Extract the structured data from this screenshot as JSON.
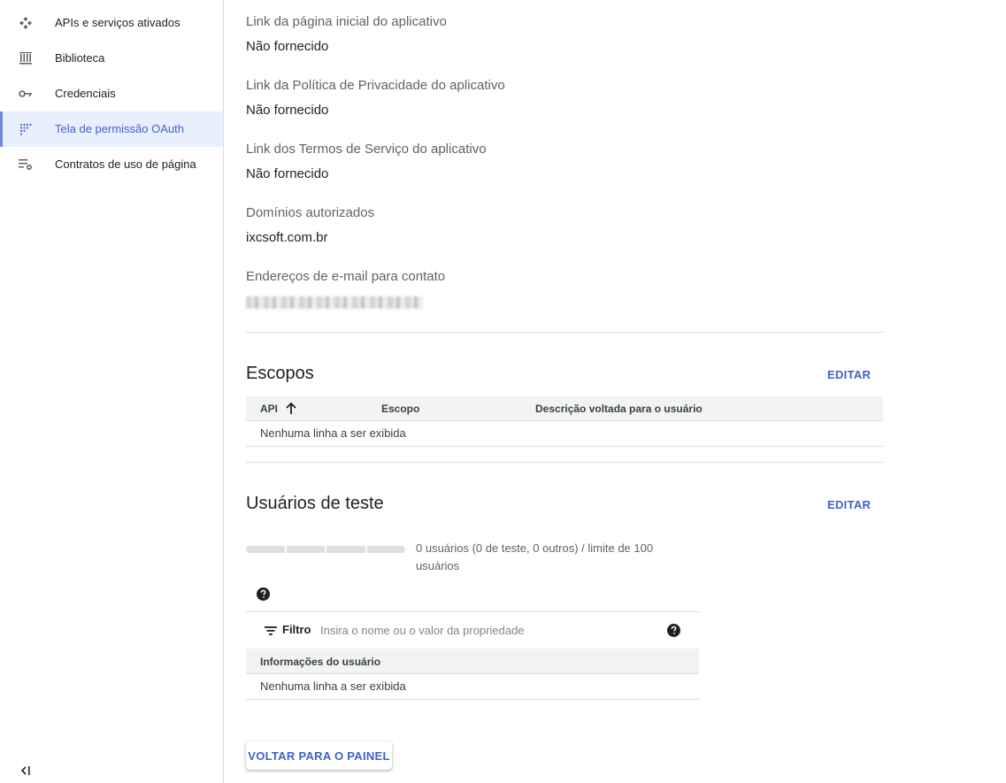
{
  "sidebar": {
    "items": [
      {
        "label": "APIs e serviços ativados",
        "icon": "apis-services-icon"
      },
      {
        "label": "Biblioteca",
        "icon": "library-icon"
      },
      {
        "label": "Credenciais",
        "icon": "key-icon"
      },
      {
        "label": "Tela de permissão OAuth",
        "icon": "oauth-consent-icon",
        "active": true
      },
      {
        "label": "Contratos de uso de página",
        "icon": "page-agreements-icon"
      }
    ],
    "collapse_icon": "collapse-sidebar-icon"
  },
  "app_info": {
    "homepage_label": "Link da página inicial do aplicativo",
    "homepage_value": "Não fornecido",
    "privacy_label": "Link da Política de Privacidade do aplicativo",
    "privacy_value": "Não fornecido",
    "terms_label": "Link dos Termos de Serviço do aplicativo",
    "terms_value": "Não fornecido",
    "domains_label": "Domínios autorizados",
    "domains_value": "ixcsoft.com.br",
    "contact_label": "Endereços de e-mail para contato"
  },
  "scopes": {
    "title": "Escopos",
    "edit_label": "EDITAR",
    "columns": [
      "API",
      "Escopo",
      "Descrição voltada para o usuário"
    ],
    "empty_text": "Nenhuma linha a ser exibida"
  },
  "test_users": {
    "title": "Usuários de teste",
    "edit_label": "EDITAR",
    "usage_text": "0 usuários (0 de teste, 0 outros) / limite de 100 usuários",
    "usage_fraction": 0,
    "filter_label": "Filtro",
    "filter_placeholder": "Insira o nome ou o valor da propriedade",
    "column": "Informações do usuário",
    "empty_text": "Nenhuma linha a ser exibida"
  },
  "back_button_label": "VOLTAR PARA O PAINEL",
  "colors": {
    "accent": "#3f62c9",
    "active_bg": "#e8f0fe",
    "divider": "#dadce0"
  }
}
